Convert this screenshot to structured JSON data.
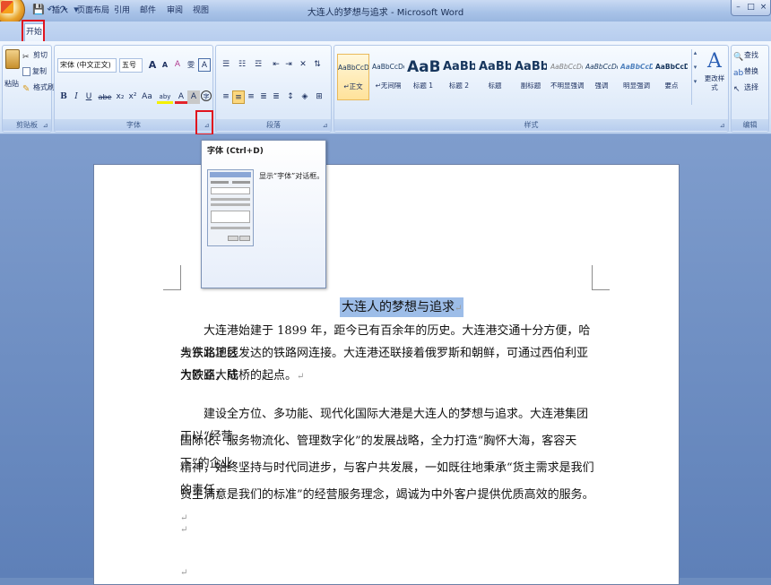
{
  "window": {
    "title": "大连人的梦想与追求 - Microsoft Word",
    "controls": [
      "–",
      "□",
      "×"
    ]
  },
  "quick_access": {
    "save": "💾",
    "undo": "↶",
    "redo": "↷",
    "customize": "▾"
  },
  "tabs": [
    {
      "label": "开始",
      "active": true
    },
    {
      "label": "插入"
    },
    {
      "label": "页面布局"
    },
    {
      "label": "引用"
    },
    {
      "label": "邮件"
    },
    {
      "label": "审阅"
    },
    {
      "label": "视图"
    }
  ],
  "clipboard": {
    "group_label": "剪贴板",
    "paste": "粘贴",
    "cut": "剪切",
    "copy": "复制",
    "format_painter": "格式刷"
  },
  "font": {
    "group_label": "字体",
    "font_name": "宋体 (中文正文)",
    "font_size": "五号",
    "bold": "B",
    "italic": "I",
    "underline": "U",
    "strike": "abe",
    "subscript": "x₂",
    "superscript": "x²",
    "change_case": "Aa",
    "grow": "A",
    "shrink": "A",
    "clear": "A",
    "phonetic": "雯",
    "border": "A",
    "highlight": "aby",
    "color": "A",
    "char_shading": "A",
    "enclose": "字"
  },
  "paragraph": {
    "group_label": "段落"
  },
  "styles": {
    "group_label": "样式",
    "items": [
      {
        "preview": "AaBbCcDd",
        "name": "↵正文"
      },
      {
        "preview": "AaBbCcDd",
        "name": "↵无间隔"
      },
      {
        "preview": "AaBl",
        "name": "标题 1"
      },
      {
        "preview": "AaBb(",
        "name": "标题 2"
      },
      {
        "preview": "AaBb(",
        "name": "标题"
      },
      {
        "preview": "AaBb(",
        "name": "副标题"
      },
      {
        "preview": "AaBbCcDd",
        "name": "不明显强调"
      },
      {
        "preview": "AaBbCcDd",
        "name": "强调"
      },
      {
        "preview": "AaBbCcDd",
        "name": "明显强调"
      },
      {
        "preview": "AaBbCcDd",
        "name": "要点"
      }
    ],
    "change_styles": "更改样式"
  },
  "editing": {
    "group_label": "编辑",
    "find": "查找",
    "replace": "替换",
    "select": "选择"
  },
  "tooltip": {
    "title": "字体 (Ctrl+D)",
    "description": "显示“字体”对话框。"
  },
  "document": {
    "title": "大连人的梦想与追求",
    "lines": [
      "大连港始建于 1899 年，距今已有百余年的历史。大连港交通十分方便，哈大铁路正线",
      "与东北地区发达的铁路网连接。大连港还联接着俄罗斯和朝鲜，可通过西伯利亚大铁路，成",
      "为欧亚大陆桥的起点。",
      "建设全方位、多功能、现代化国际大港是大连人的梦想与追求。大连港集团正以“经营",
      "国际化、服务物流化、管理数字化”的发展战略，全力打造“胸怀大海，客容天下”的企业",
      "精神，始终坚持与时代同进步，与客户共发展，一如既往地秉承“货主需求是我们的责任，",
      "货主满意是我们的标准”的经营服务理念，竭诚为中外客户提供优质高效的服务。"
    ],
    "para_mark": "↵",
    "empty_mark": "↵"
  }
}
